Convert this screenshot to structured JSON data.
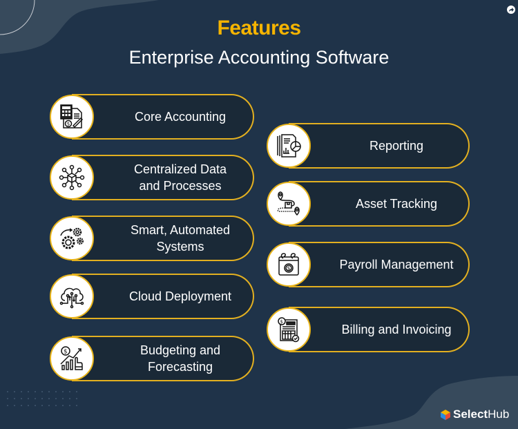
{
  "header": {
    "title": "Features",
    "subtitle": "Enterprise Accounting Software"
  },
  "colors": {
    "background": "#1f3349",
    "accent_gold": "#f5b400",
    "pill_border": "#e3b020",
    "pill_fill": "#1a2937",
    "icon_bg": "#ffffff"
  },
  "features_left": [
    {
      "label": "Core Accounting",
      "icon": "calculator-document-icon"
    },
    {
      "label": "Centralized Data and Processes",
      "icon": "network-cube-icon"
    },
    {
      "label": "Smart, Automated Systems",
      "icon": "gears-icon"
    },
    {
      "label": "Cloud Deployment",
      "icon": "cloud-circuit-icon"
    },
    {
      "label": "Budgeting and Forecasting",
      "icon": "growth-chart-icon"
    }
  ],
  "features_right": [
    {
      "label": "Reporting",
      "icon": "report-pie-chart-icon"
    },
    {
      "label": "Asset Tracking",
      "icon": "location-package-icon"
    },
    {
      "label": "Payroll Management",
      "icon": "calendar-dollar-icon"
    },
    {
      "label": "Billing and Invoicing",
      "icon": "invoice-check-icon"
    }
  ],
  "brand": {
    "name_bold": "Select",
    "name_regular": "Hub"
  }
}
